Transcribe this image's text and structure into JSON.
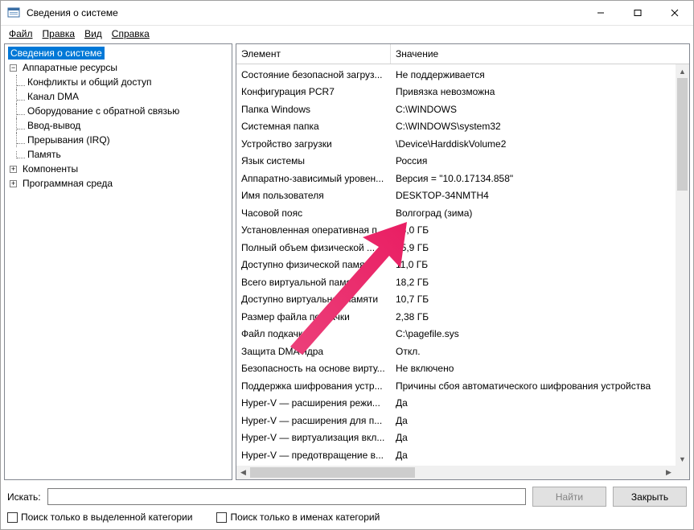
{
  "titlebar": {
    "title": "Сведения о системе"
  },
  "menu": {
    "file": "Файл",
    "edit": "Правка",
    "view": "Вид",
    "help": "Справка"
  },
  "tree": {
    "root": "Сведения о системе",
    "hardware": "Аппаратные ресурсы",
    "hw_children": [
      "Конфликты и общий доступ",
      "Канал DMA",
      "Оборудование с обратной связью",
      "Ввод-вывод",
      "Прерывания (IRQ)",
      "Память"
    ],
    "components": "Компоненты",
    "software_env": "Программная среда"
  },
  "list": {
    "col_element": "Элемент",
    "col_value": "Значение",
    "rows": [
      {
        "el": "Состояние безопасной загруз...",
        "val": "Не поддерживается"
      },
      {
        "el": "Конфигурация PCR7",
        "val": "Привязка невозможна"
      },
      {
        "el": "Папка Windows",
        "val": "C:\\WINDOWS"
      },
      {
        "el": "Системная папка",
        "val": "C:\\WINDOWS\\system32"
      },
      {
        "el": "Устройство загрузки",
        "val": "\\Device\\HarddiskVolume2"
      },
      {
        "el": "Язык системы",
        "val": "Россия"
      },
      {
        "el": "Аппаратно-зависимый уровен...",
        "val": "Версия = \"10.0.17134.858\""
      },
      {
        "el": "Имя пользователя",
        "val": "DESKTOP-34NMTH4"
      },
      {
        "el": "Часовой пояс",
        "val": "Волгоград (зима)"
      },
      {
        "el": "Установленная оперативная п...",
        "val": "16,0 ГБ"
      },
      {
        "el": "Полный объем физической ...",
        "val": "15,9 ГБ"
      },
      {
        "el": "Доступно физической памяти",
        "val": "11,0 ГБ"
      },
      {
        "el": "Всего виртуальной памяти",
        "val": "18,2 ГБ"
      },
      {
        "el": "Доступно виртуальной памяти",
        "val": "10,7 ГБ"
      },
      {
        "el": "Размер файла подкачки",
        "val": "2,38 ГБ"
      },
      {
        "el": "Файл подкачки",
        "val": "C:\\pagefile.sys"
      },
      {
        "el": "Защита DMA ядра",
        "val": "Откл."
      },
      {
        "el": "Безопасность на основе вирту...",
        "val": "Не включено"
      },
      {
        "el": "Поддержка шифрования устр...",
        "val": "Причины сбоя автоматического шифрования устройства"
      },
      {
        "el": "Hyper-V — расширения режи...",
        "val": "Да"
      },
      {
        "el": "Hyper-V — расширения для п...",
        "val": "Да"
      },
      {
        "el": "Hyper-V — виртуализация вкл...",
        "val": "Да"
      },
      {
        "el": "Hyper-V — предотвращение в...",
        "val": "Да"
      }
    ]
  },
  "search": {
    "label": "Искать:",
    "find_btn": "Найти",
    "close_btn": "Закрыть",
    "chk_selected": "Поиск только в выделенной категории",
    "chk_names": "Поиск только в именах категорий"
  },
  "annotation": {
    "arrow_color": "#e91e63"
  }
}
